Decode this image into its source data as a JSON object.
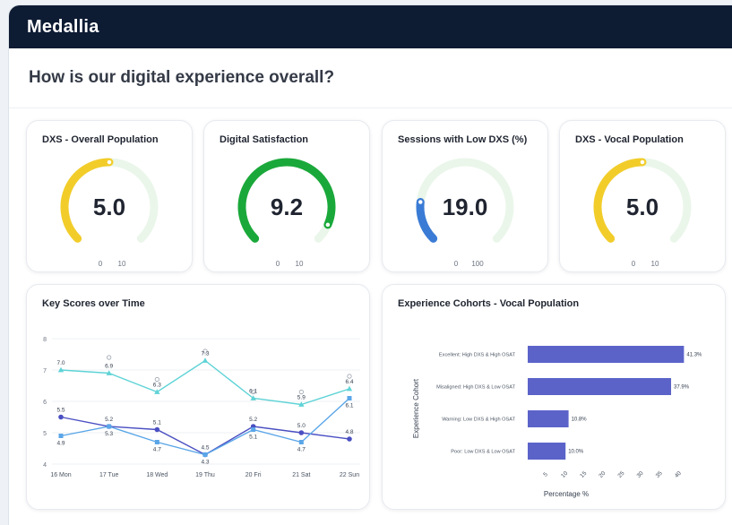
{
  "header": {
    "brand": "Medallia"
  },
  "page": {
    "title": "How is our digital experience overall?"
  },
  "colors": {
    "yellow": "#f2cd2a",
    "green": "#1aa83a",
    "blue": "#3a7bd5",
    "track": "#eaf6ea",
    "teal": "#5fd3d6",
    "navy": "#4a4fc2",
    "lightblue": "#5aa6e8",
    "bar": "#5b63c9"
  },
  "gauges": [
    {
      "title": "DXS - Overall Population",
      "value": 5.0,
      "display": "5.0",
      "min_label": "0",
      "max_label": "10",
      "max": 10,
      "color": "yellow"
    },
    {
      "title": "Digital Satisfaction",
      "value": 9.2,
      "display": "9.2",
      "min_label": "0",
      "max_label": "10",
      "max": 10,
      "color": "green"
    },
    {
      "title": "Sessions with Low DXS (%)",
      "value": 19.0,
      "display": "19.0",
      "min_label": "0",
      "max_label": "100",
      "max": 100,
      "color": "blue"
    },
    {
      "title": "DXS - Vocal Population",
      "value": 5.0,
      "display": "5.0",
      "min_label": "0",
      "max_label": "10",
      "max": 10,
      "color": "yellow"
    }
  ],
  "chart_data": [
    {
      "type": "line",
      "title": "Key Scores over Time",
      "categories": [
        "16 Mon",
        "17 Tue",
        "18 Wed",
        "19 Thu",
        "20 Fri",
        "21 Sat",
        "22 Sun"
      ],
      "ylim": [
        4,
        8
      ],
      "yticks": [
        "4",
        "5",
        "6",
        "7",
        "8"
      ],
      "series": [
        {
          "color": "teal",
          "marker": "triangle",
          "values": [
            7.0,
            6.9,
            6.3,
            7.3,
            6.1,
            5.9,
            6.4
          ],
          "labels": [
            "7.0",
            "6.9",
            "6.3",
            "7.3",
            "6.1",
            "5.9",
            "6.4"
          ]
        },
        {
          "color": "navy",
          "marker": "circle",
          "values": [
            5.5,
            5.2,
            5.1,
            4.3,
            5.2,
            5.0,
            4.8
          ],
          "labels": [
            "5.5",
            "5.2",
            "5.1",
            "4.5",
            "5.2",
            "5.0",
            "4.8"
          ]
        },
        {
          "color": "lightblue",
          "marker": "square",
          "values": [
            4.9,
            5.2,
            4.7,
            4.3,
            5.1,
            4.7,
            6.1
          ],
          "labels": [
            "4.9",
            "5.3",
            "4.7",
            "4.3",
            "5.1",
            "4.7",
            "6.1"
          ]
        }
      ],
      "hollow_markers": [
        null,
        7.4,
        6.7,
        7.6,
        6.3,
        6.3,
        6.8
      ]
    },
    {
      "type": "bar",
      "orientation": "horizontal",
      "title": "Experience Cohorts - Vocal Population",
      "ylabel": "Experience Cohort",
      "xlabel": "Percentage %",
      "categories": [
        "Excellent: High DXS & High OSAT",
        "Misaligned: High DXS & Low OSAT",
        "Warning: Low DXS & High OSAT",
        "Poor: Low DXS & Low OSAT"
      ],
      "values": [
        41.3,
        37.9,
        10.8,
        10.0
      ],
      "value_labels": [
        "41.3%",
        "37.9%",
        "10.8%",
        "10.0%"
      ],
      "xticks": [
        "5",
        "10",
        "15",
        "20",
        "25",
        "30",
        "35",
        "40"
      ],
      "xlim": [
        0,
        45
      ]
    }
  ]
}
